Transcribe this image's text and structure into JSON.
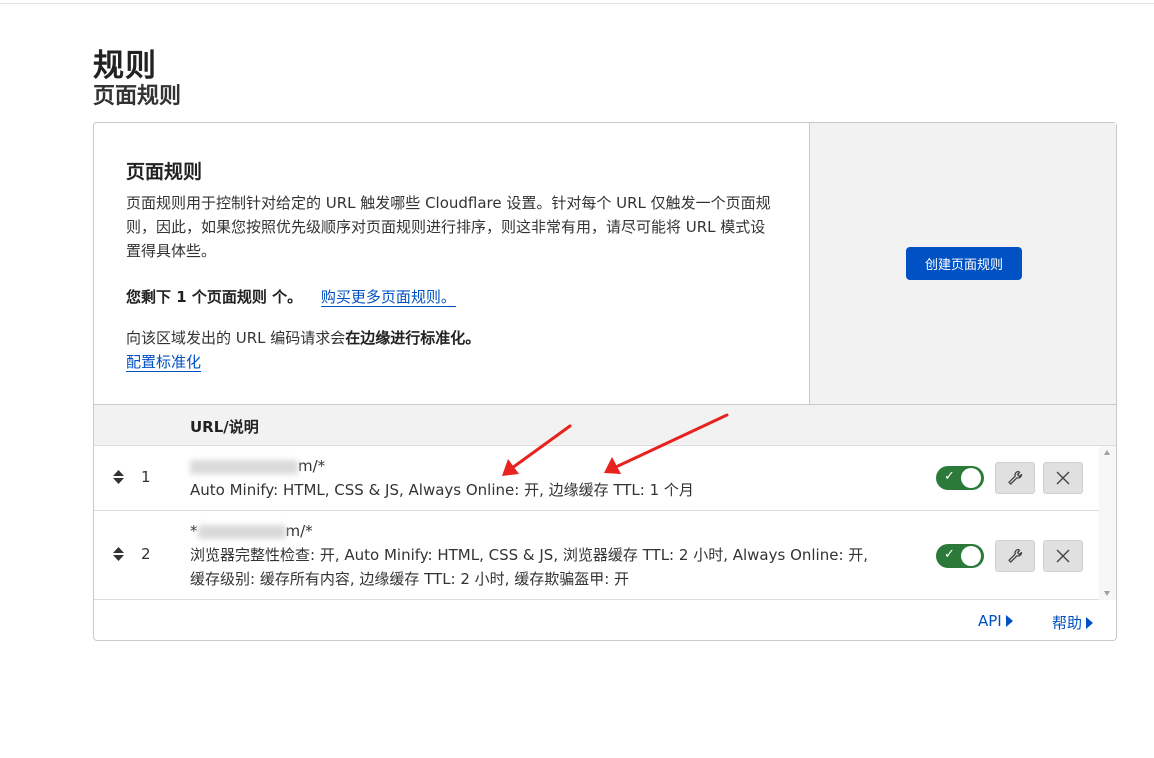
{
  "page": {
    "title": "规则",
    "subtitle": "页面规则"
  },
  "card": {
    "heading": "页面规则",
    "description": "页面规则用于控制针对给定的 URL 触发哪些 Cloudflare 设置。针对每个 URL 仅触发一个页面规则，因此，如果您按照优先级顺序对页面规则进行排序，则这非常有用，请尽可能将 URL 模式设置得具体些。",
    "remaining_text": "您剩下 1 个页面规则 个。",
    "buy_more_link": "购买更多页面规则。",
    "normalization_prefix": "向该区域发出的 URL 编码请求会",
    "normalization_bold": "在边缘进行标准化。",
    "configure_link": "配置标准化",
    "create_button": "创建页面规则"
  },
  "table": {
    "header_url": "URL/说明",
    "rows": [
      {
        "index": "1",
        "url_suffix": "m/*",
        "description": "Auto Minify: HTML, CSS & JS, Always Online: 开, 边缘缓存 TTL: 1 个月",
        "enabled": true
      },
      {
        "index": "2",
        "url_prefix": "*",
        "url_suffix": "m/*",
        "description_line1": "浏览器完整性检查: 开, Auto Minify: HTML, CSS & JS, 浏览器缓存 TTL: 2 小时, Always Online: 开,",
        "description_line2": "缓存级别: 缓存所有内容, 边缘缓存 TTL: 2 小时, 缓存欺骗盔甲: 开",
        "enabled": true
      }
    ]
  },
  "footer": {
    "api_link": "API",
    "help_link": "帮助"
  },
  "colors": {
    "primary": "#0051c3",
    "toggle_on": "#2c7a3a",
    "annotation_arrow": "#e8231f"
  },
  "icons": [
    "sort-icon",
    "check-icon",
    "wrench-icon",
    "close-icon",
    "play-triangle-icon"
  ]
}
